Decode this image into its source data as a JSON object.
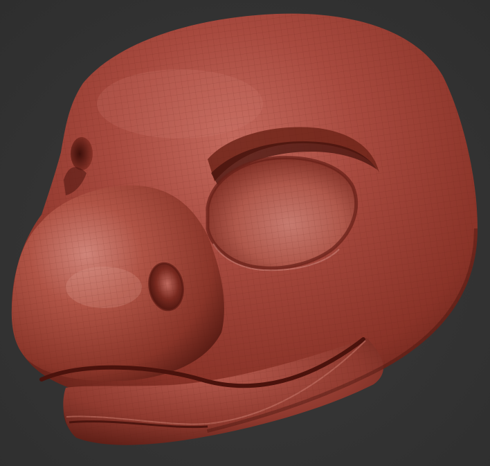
{
  "viewport": {
    "background_top": "#2e2e2e",
    "background_bottom": "#484848",
    "background_center": "#3a3a3a"
  },
  "model": {
    "subject": "sculpted-animal-head-mask",
    "material": "clay",
    "base_color": "#a8463c",
    "highlight_color": "#d98a7e",
    "shadow_color": "#4e1711",
    "wireframe_visible": true,
    "wireframe_color": "#6a2219"
  }
}
